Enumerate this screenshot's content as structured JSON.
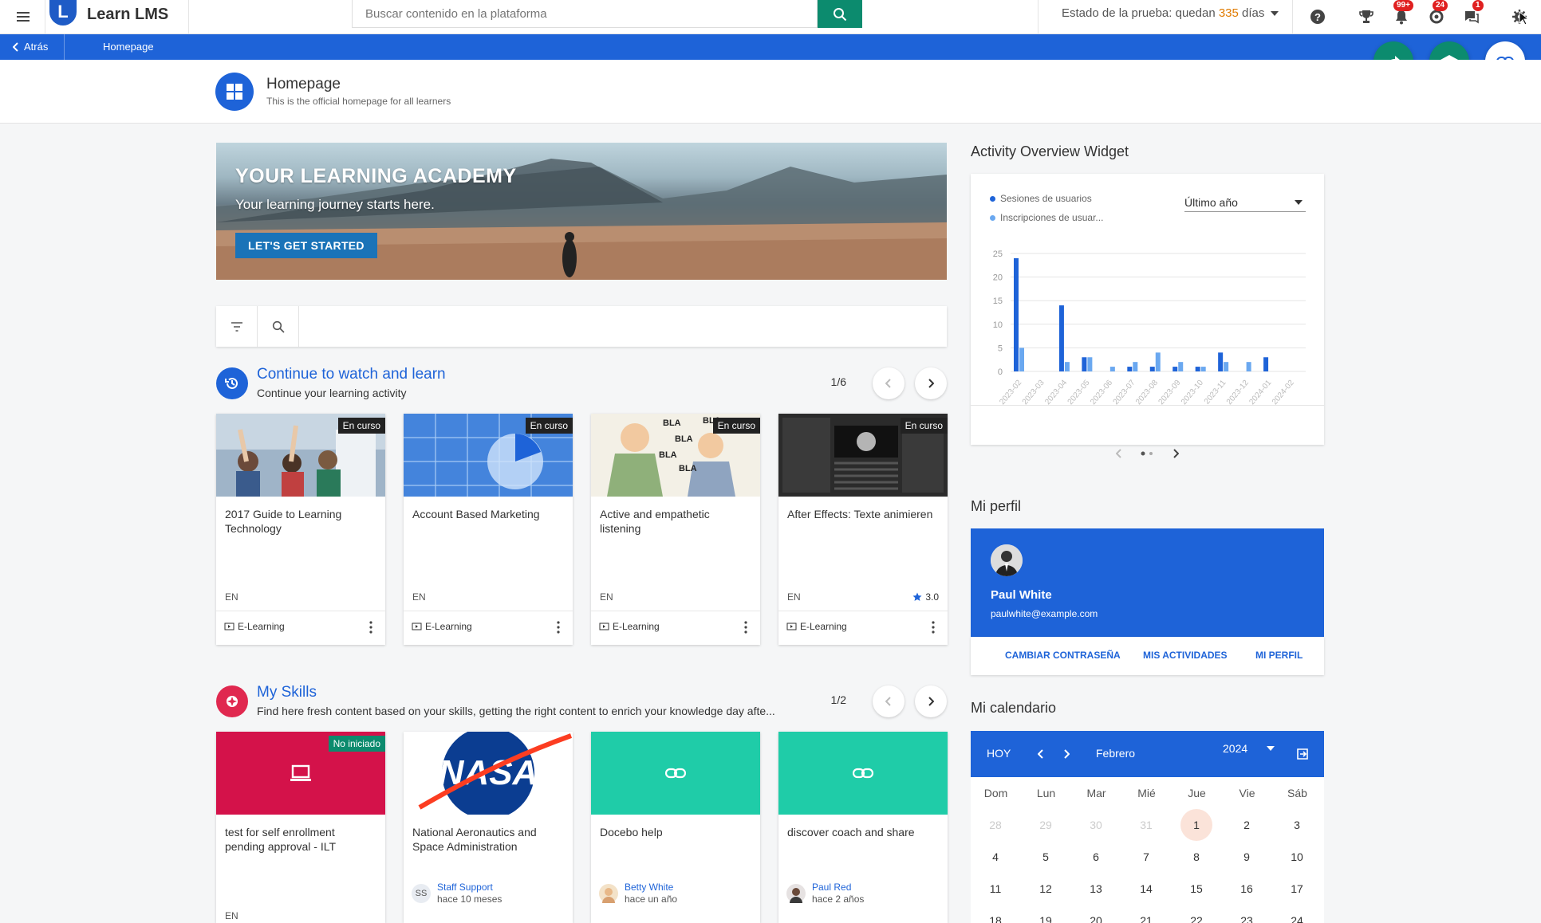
{
  "topbar": {
    "brand": "Learn LMS",
    "search_placeholder": "Buscar contenido en la plataforma",
    "trial_label": "Estado de la prueba: quedan",
    "trial_days": "335",
    "trial_unit": "días",
    "badges": {
      "notifications": "99+",
      "messages": "24",
      "chat": "1"
    }
  },
  "breadcrumb": {
    "back": "Atrás",
    "current": "Homepage"
  },
  "page": {
    "title": "Homepage",
    "subtitle": "This is the official homepage for all learners"
  },
  "hero": {
    "title": "YOUR LEARNING ACADEMY",
    "subtitle": "Your learning journey starts here.",
    "cta": "LET'S GET STARTED"
  },
  "continue_section": {
    "title": "Continue to watch and learn",
    "subtitle": "Continue your learning activity",
    "pager": "1/6",
    "cards": [
      {
        "title": "2017 Guide to Learning Technology",
        "status": "En curso",
        "lang": "EN",
        "type": "E-Learning"
      },
      {
        "title": "Account Based Marketing",
        "status": "En curso",
        "lang": "EN",
        "type": "E-Learning"
      },
      {
        "title": "Active and empathetic listening",
        "status": "En curso",
        "lang": "EN",
        "type": "E-Learning"
      },
      {
        "title": "After Effects: Texte animieren",
        "status": "En curso",
        "lang": "EN",
        "type": "E-Learning",
        "rating": "3.0"
      }
    ]
  },
  "skills_section": {
    "title": "My Skills",
    "subtitle": "Find here fresh content based on your skills, getting the right content to enrich your knowledge day afte...",
    "pager": "1/2",
    "cards": [
      {
        "title": "test for self enrollment pending approval - ILT",
        "status": "No iniciado",
        "lang": "EN"
      },
      {
        "title": "National Aeronautics and Space Administration",
        "author": "Staff Support",
        "author_initials": "SS",
        "ago": "hace 10 meses",
        "logo_text": "NASA"
      },
      {
        "title": "Docebo help",
        "author": "Betty White",
        "ago": "hace un año"
      },
      {
        "title": "discover coach and share",
        "author": "Paul Red",
        "ago": "hace 2 años"
      }
    ]
  },
  "activity_widget": {
    "title": "Activity Overview Widget",
    "legend": [
      "Sesiones de usuarios",
      "Inscripciones de usuar..."
    ],
    "period": "Último año"
  },
  "chart_data": {
    "type": "bar",
    "categories": [
      "2023-02",
      "2023-03",
      "2023-04",
      "2023-05",
      "2023-06",
      "2023-07",
      "2023-08",
      "2023-09",
      "2023-10",
      "2023-11",
      "2023-12",
      "2024-01",
      "2024-02"
    ],
    "series": [
      {
        "name": "Sesiones de usuarios",
        "color": "#1e63d8",
        "values": [
          24,
          0,
          14,
          3,
          0,
          1,
          1,
          1,
          1,
          4,
          0,
          3,
          0
        ]
      },
      {
        "name": "Inscripciones de usuar...",
        "color": "#6aa8f0",
        "values": [
          5,
          0,
          2,
          3,
          1,
          2,
          4,
          2,
          1,
          2,
          2,
          0,
          0
        ]
      }
    ],
    "ylim": [
      0,
      25
    ],
    "yticks": [
      "0",
      "5",
      "10",
      "15",
      "20",
      "25"
    ],
    "grid": true
  },
  "profile": {
    "section_title": "Mi perfil",
    "name": "Paul White",
    "email": "paulwhite@example.com",
    "links": [
      "CAMBIAR CONTRASEÑA",
      "MIS ACTIVIDADES",
      "MI PERFIL"
    ]
  },
  "calendar": {
    "section_title": "Mi calendario",
    "today_label": "HOY",
    "month": "Febrero",
    "year": "2024",
    "weekdays": [
      "Dom",
      "Lun",
      "Mar",
      "Mié",
      "Jue",
      "Vie",
      "Sáb"
    ],
    "weeks": [
      [
        "28",
        "29",
        "30",
        "31",
        "1",
        "2",
        "3"
      ],
      [
        "4",
        "5",
        "6",
        "7",
        "8",
        "9",
        "10"
      ],
      [
        "11",
        "12",
        "13",
        "14",
        "15",
        "16",
        "17"
      ],
      [
        "18",
        "19",
        "20",
        "21",
        "22",
        "23",
        "24"
      ]
    ]
  },
  "colors": {
    "primary": "#1e63d8",
    "green": "#0c8b6e",
    "accent_orange": "#e07b00",
    "skills_red": "#e0284f",
    "teal": "#1fcca8"
  }
}
